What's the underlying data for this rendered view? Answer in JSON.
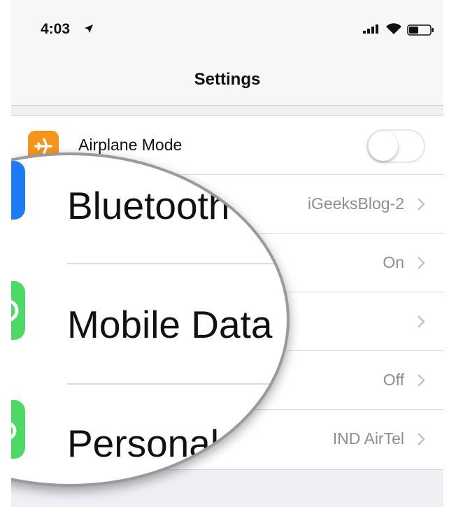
{
  "status_bar": {
    "time": "4:03"
  },
  "nav": {
    "title": "Settings"
  },
  "settings": {
    "airplane_label": "Airplane Mode",
    "airplane_on": false,
    "rows": [
      {
        "value": "iGeeksBlog-2"
      },
      {
        "value": "On"
      },
      {
        "value": ""
      },
      {
        "value": "Off"
      },
      {
        "value": "IND AirTel"
      }
    ]
  },
  "magnified": {
    "bluetooth": "Bluetooth",
    "mobile_data": "Mobile Data",
    "personal": "Personal I"
  },
  "colors": {
    "airplane_icon": "#f7951b",
    "bluetooth_icon": "#1e7bf6",
    "mobile_icon": "#4cd964",
    "hotspot_icon": "#4cd964",
    "value_gray": "#8e8e93"
  }
}
